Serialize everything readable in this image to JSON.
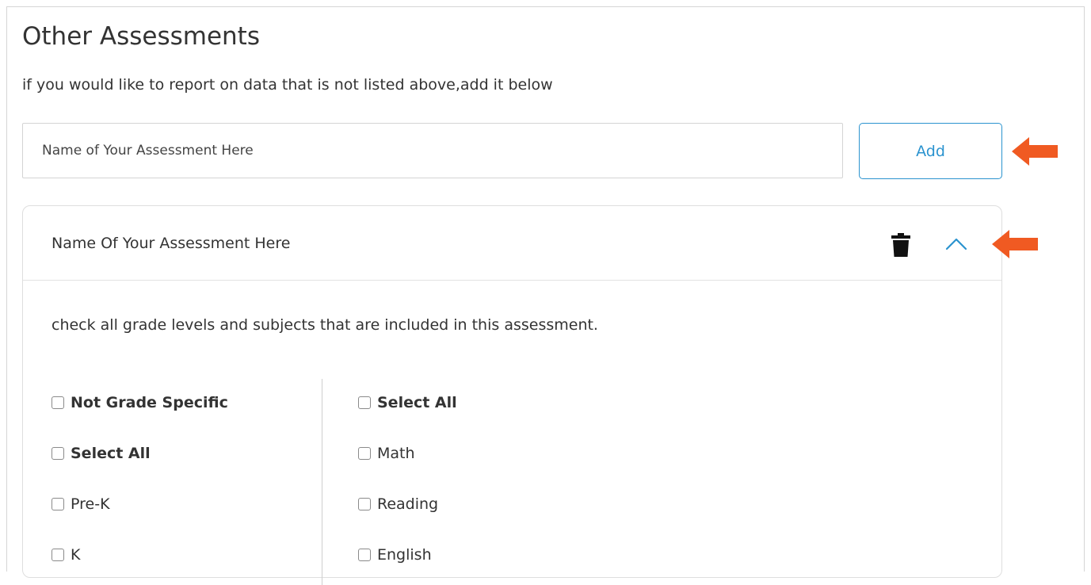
{
  "section": {
    "title": "Other Assessments",
    "subtitle": "if you would like to report on data that is not listed above,add it below"
  },
  "name_input": {
    "placeholder": "Name of Your Assessment Here",
    "value": ""
  },
  "add_button": {
    "label": "Add"
  },
  "assessment_card": {
    "title": "Name Of Your Assessment Here",
    "icons": {
      "delete": "trash-icon",
      "collapse": "chevron-up-icon"
    },
    "instruction": "check all grade levels and subjects that are included in this assessment.",
    "grades": [
      {
        "label": "Not Grade Specific",
        "checked": false,
        "bold": true
      },
      {
        "label": "Select All",
        "checked": false,
        "bold": true
      },
      {
        "label": "Pre-K",
        "checked": false,
        "bold": false
      },
      {
        "label": "K",
        "checked": false,
        "bold": false
      }
    ],
    "subjects": [
      {
        "label": "Select All",
        "checked": false,
        "bold": true
      },
      {
        "label": "Math",
        "checked": false,
        "bold": false
      },
      {
        "label": "Reading",
        "checked": false,
        "bold": false
      },
      {
        "label": "English",
        "checked": false,
        "bold": false
      }
    ]
  },
  "colors": {
    "accent": "#2b93cf",
    "annotation_arrow": "#f05a22",
    "border": "#d6d6d6",
    "text": "#333333"
  }
}
